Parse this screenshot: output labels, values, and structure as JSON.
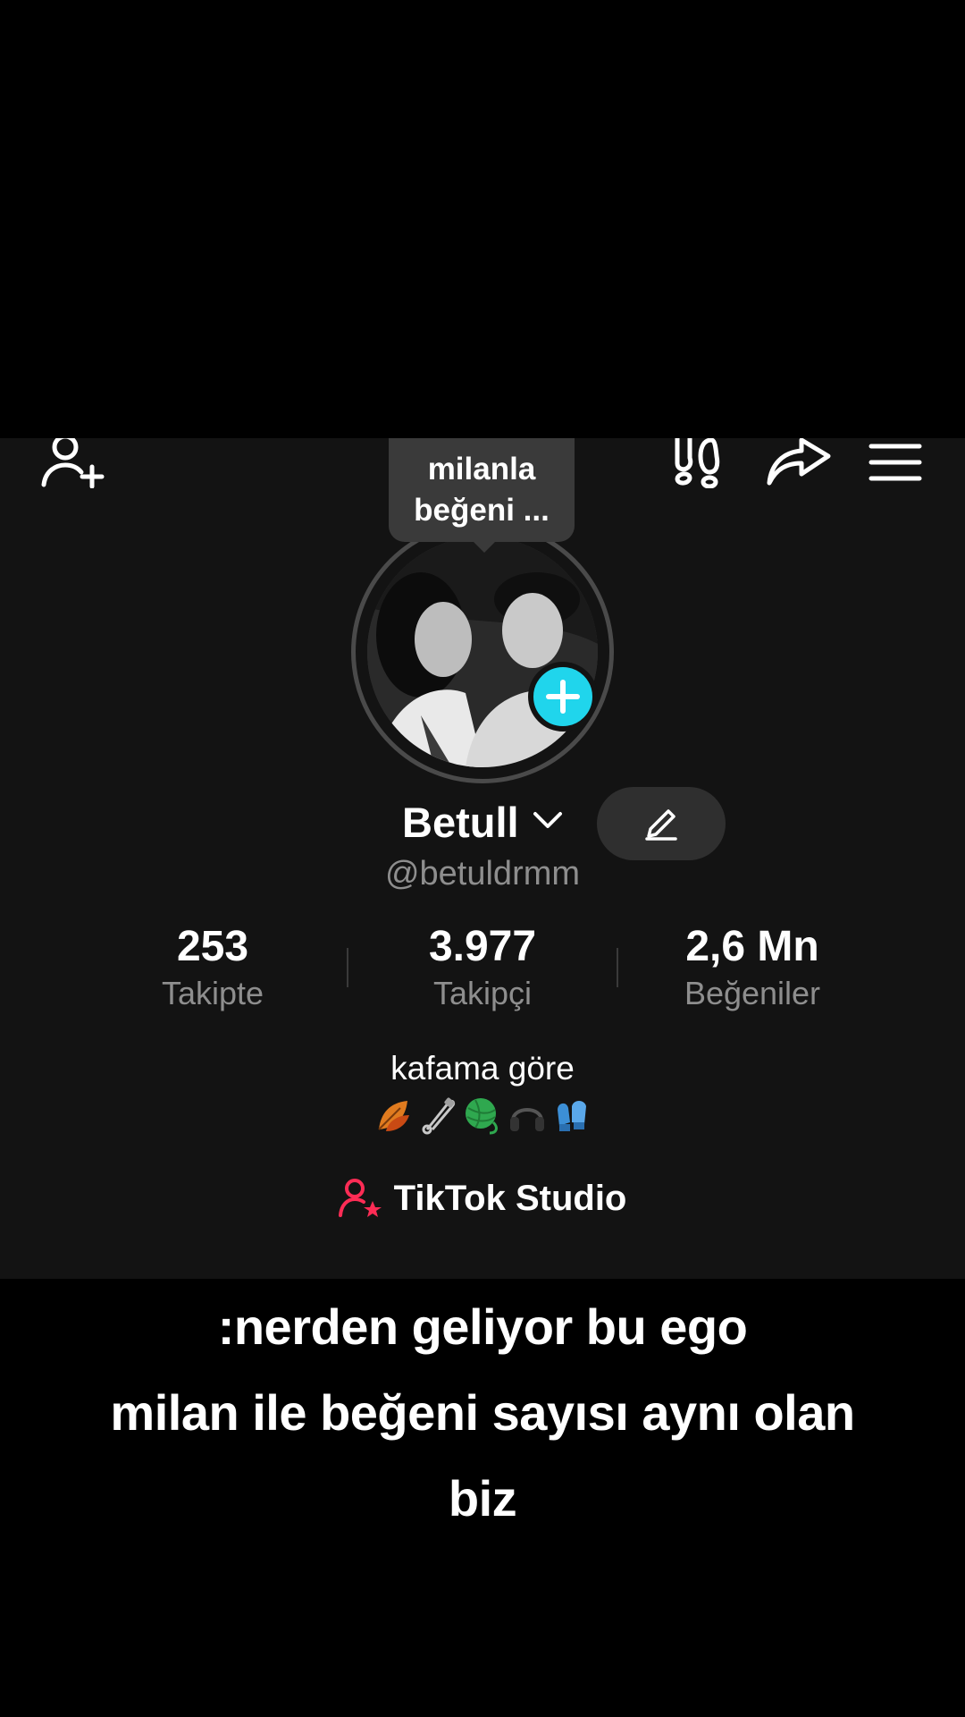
{
  "tooltip": {
    "line1": "milanla",
    "line2": "beğeni ..."
  },
  "profile": {
    "display_name": "Betull",
    "username": "@betuldrmm",
    "bio": "kafama göre"
  },
  "stats": [
    {
      "value": "253",
      "label": "Takipte"
    },
    {
      "value": "3.977",
      "label": "Takipçi"
    },
    {
      "value": "2,6 Mn",
      "label": "Beğeniler"
    }
  ],
  "studio": {
    "label": "TikTok Studio"
  },
  "caption": {
    "line1": ":nerden geliyor bu ego",
    "line2": "milan ile beğeni sayısı aynı olan",
    "line3": "biz"
  },
  "icons": {
    "add_friend": "person-plus-icon",
    "footprints": "footprints-icon",
    "share": "share-arrow-icon",
    "menu": "hamburger-menu-icon",
    "edit": "pencil-icon",
    "studio": "person-star-icon",
    "bio_emojis": [
      "autumn-leaf-icon",
      "safety-pin-icon",
      "yarn-ball-icon",
      "headphones-icon",
      "gloves-icon"
    ]
  },
  "colors": {
    "accent": "#20d5ec",
    "studio_icon": "#fe2c55",
    "panel": "#131313"
  }
}
